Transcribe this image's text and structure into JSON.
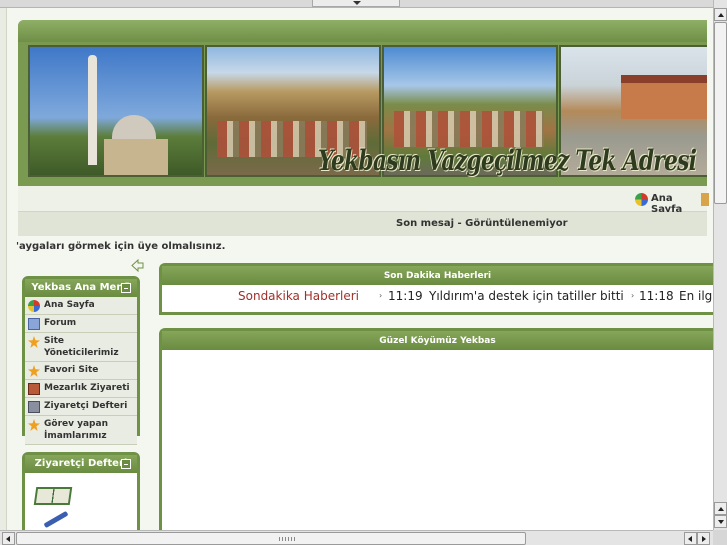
{
  "header": {
    "banner_text": "Yekbasın Vazgeçilmez Tek Adresi",
    "photos": [
      "mosque-photo",
      "village-photo",
      "valley-photo",
      "school-photo"
    ]
  },
  "nav": {
    "home_label": "Ana Sayfa",
    "home_icon": "globe-icon"
  },
  "info": {
    "last_message": "Son mesaj - Görüntülenemiyor"
  },
  "notice": "'aygaları görmek için üye olmalısınız.",
  "left_menu": {
    "title": "Yekbas Ana Menü",
    "items": [
      {
        "label": "Ana Sayfa",
        "icon": "globe-icon"
      },
      {
        "label": "Forum",
        "icon": "forum-icon"
      },
      {
        "label": "Site Yöneticilerimiz",
        "icon": "star-icon"
      },
      {
        "label": "Favori Site",
        "icon": "star-icon"
      },
      {
        "label": "Mezarlık Ziyareti",
        "icon": "grave-icon"
      },
      {
        "label": "Ziyaretçi Defteri",
        "icon": "book-icon"
      },
      {
        "label": "Görev yapan İmamlarımız",
        "icon": "star-icon"
      }
    ]
  },
  "guestbook_box": {
    "title": "Ziyaretçi Defteri"
  },
  "news": {
    "title": "Son Dakika Haberleri",
    "label": "Sondakika Haberleri",
    "items": [
      {
        "time": "11:19",
        "text": "Yıldırım'a destek için tatiller bitti"
      },
      {
        "time": "11:18",
        "text": "En ilgi"
      }
    ]
  },
  "main_panel": {
    "title": "Güzel Köyümüz Yekbas"
  },
  "colors": {
    "accent_green": "#6f9146",
    "news_label": "#a0302a"
  }
}
